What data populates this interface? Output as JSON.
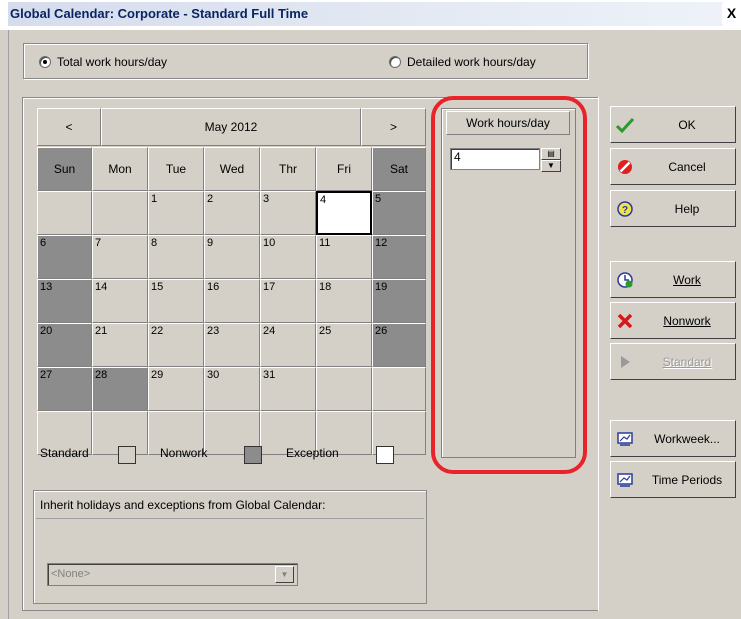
{
  "window": {
    "title": "Global Calendar: Corporate - Standard Full Time",
    "close": "X"
  },
  "mode": {
    "total_label": "Total work hours/day",
    "detailed_label": "Detailed work hours/day",
    "selected": "total"
  },
  "calendar": {
    "prev": "<",
    "next": ">",
    "month": "May 2012",
    "days": [
      "Sun",
      "Mon",
      "Tue",
      "Wed",
      "Thr",
      "Fri",
      "Sat"
    ],
    "weeks": [
      [
        "",
        "",
        "1",
        "2",
        "3",
        "4",
        "5"
      ],
      [
        "6",
        "7",
        "8",
        "9",
        "10",
        "11",
        "12"
      ],
      [
        "13",
        "14",
        "15",
        "16",
        "17",
        "18",
        "19"
      ],
      [
        "20",
        "21",
        "22",
        "23",
        "24",
        "25",
        "26"
      ],
      [
        "27",
        "28",
        "29",
        "30",
        "31",
        "",
        ""
      ],
      [
        "",
        "",
        "",
        "",
        "",
        "",
        ""
      ]
    ]
  },
  "legend": {
    "standard": "Standard",
    "nonwork": "Nonwork",
    "exception": "Exception"
  },
  "work_hours": {
    "header": "Work hours/day",
    "value": "4"
  },
  "inherit": {
    "label": "Inherit holidays and exceptions from Global Calendar:",
    "value": "<None>"
  },
  "buttons": {
    "ok": "OK",
    "cancel": "Cancel",
    "help": "Help",
    "work": "Work",
    "nonwork": "Nonwork",
    "standard": "Standard",
    "workweek": "Workweek...",
    "time_periods": "Time Periods"
  },
  "colors": {
    "dialog_bg": "#d4d0c8",
    "nonwork_cell": "#8c8c8c",
    "highlight_ring": "#e8232a",
    "title_text": "#0a2464"
  }
}
